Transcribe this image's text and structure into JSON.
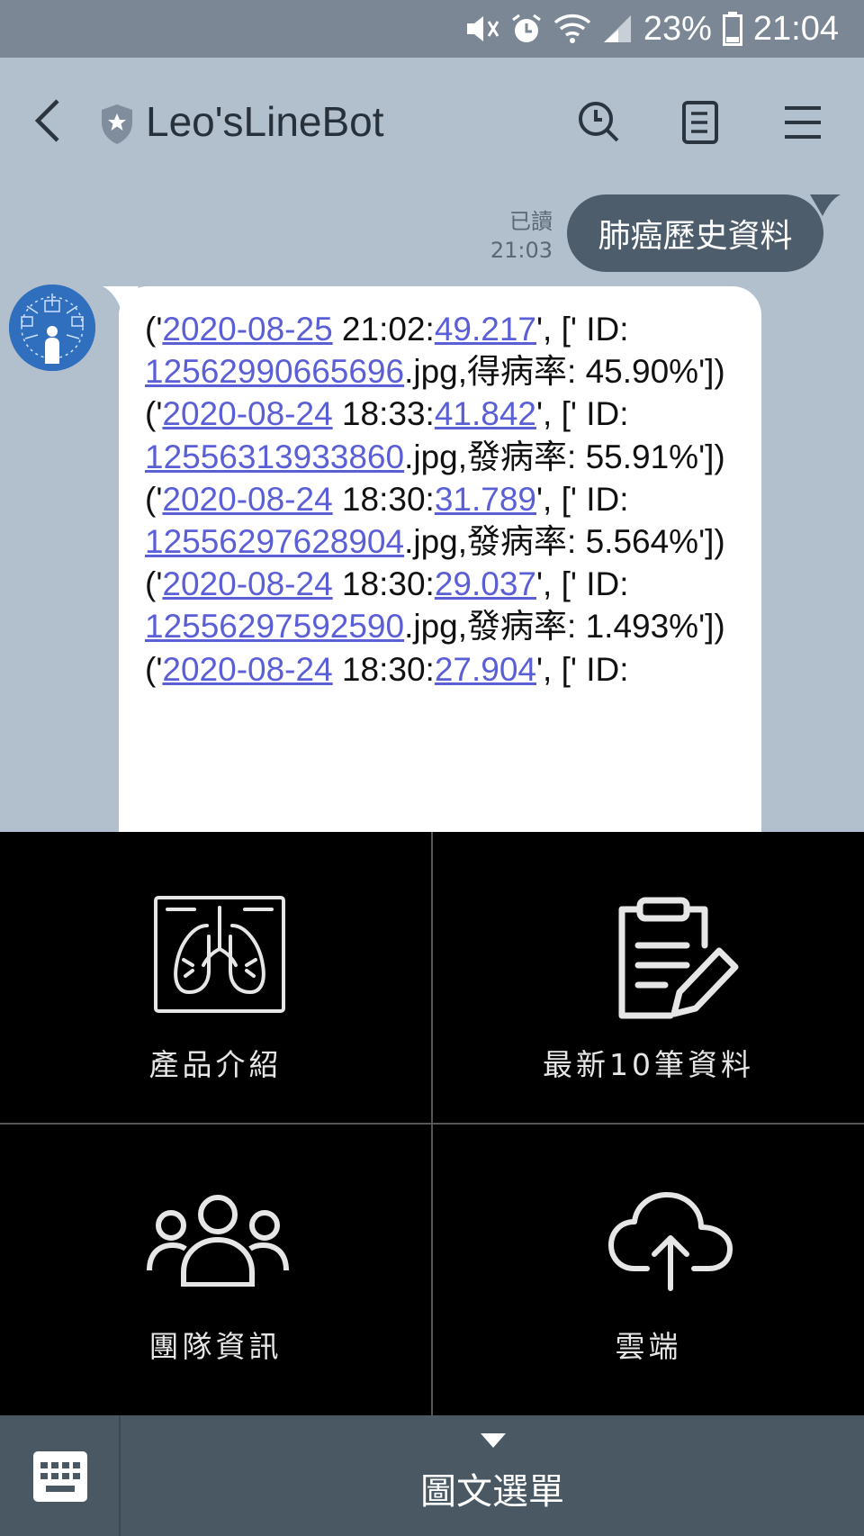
{
  "status": {
    "battery": "23%",
    "time": "21:04"
  },
  "header": {
    "title": "Leo'sLineBot"
  },
  "chat": {
    "outgoing": {
      "read_label": "已讀",
      "time": "21:03",
      "text": "肺癌歷史資料"
    },
    "records": [
      {
        "date": "2020-08-25",
        "time_a": " 21:02:",
        "sec": "49.217",
        "mid": "', [' ID: ",
        "id": "12562990665696",
        "rate_label": ".jpg,得病率: ",
        "rate": "45.90%'])"
      },
      {
        "date": "2020-08-24",
        "time_a": " 18:33:",
        "sec": "41.842",
        "mid": "', [' ID: ",
        "id": "12556313933860",
        "rate_label": ".jpg,發病率: ",
        "rate": "55.91%'])"
      },
      {
        "date": "2020-08-24",
        "time_a": " 18:30:",
        "sec": "31.789",
        "mid": "', [' ID: ",
        "id": "12556297628904",
        "rate_label": ".jpg,發病率: ",
        "rate": "5.564%'])"
      },
      {
        "date": "2020-08-24",
        "time_a": " 18:30:",
        "sec": "29.037",
        "mid": "', [' ID: ",
        "id": "12556297592590",
        "rate_label": ".jpg,發病率: ",
        "rate": "1.493%'])"
      },
      {
        "date": "2020-08-24",
        "time_a": " 18:30:",
        "sec": "27.904",
        "mid": "', [' ID: ",
        "id": "",
        "rate_label": "",
        "rate": ""
      }
    ]
  },
  "menu": {
    "items": [
      {
        "label": "產品介紹",
        "icon": "lung-xray-icon"
      },
      {
        "label": "最新10筆資料",
        "icon": "clipboard-edit-icon"
      },
      {
        "label": "團隊資訊",
        "icon": "team-icon"
      },
      {
        "label": "雲端",
        "icon": "cloud-upload-icon"
      }
    ]
  },
  "bottom": {
    "menu_label": "圖文選單"
  },
  "colors": {
    "link": "#5b5fd6",
    "chat_bg": "#b2bfcd",
    "outgoing_bubble": "#4e5d6b",
    "menu_bg": "#000000"
  }
}
